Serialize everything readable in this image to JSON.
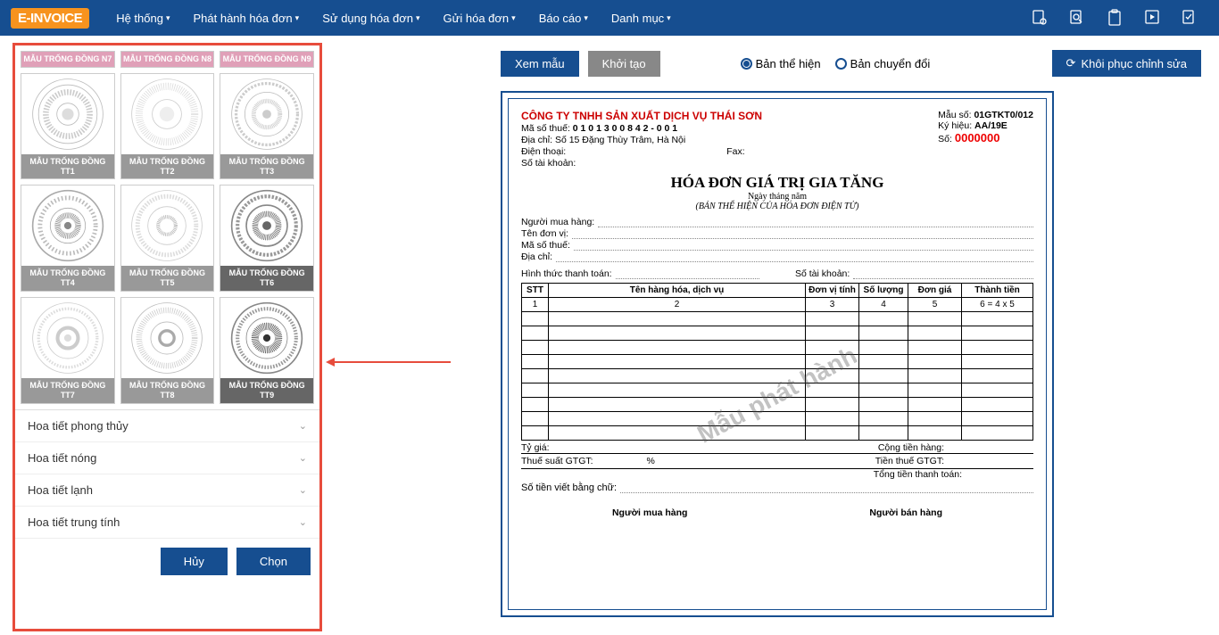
{
  "nav": {
    "logo_a": "E-",
    "logo_b": "INVOICE",
    "items": [
      "Hệ thống",
      "Phát hành hóa đơn",
      "Sử dụng hóa đơn",
      "Gửi hóa đơn",
      "Báo cáo",
      "Danh mục"
    ]
  },
  "templates": {
    "row0": [
      "MẪU TRỐNG ĐỒNG N7",
      "MẪU TRỐNG ĐỒNG N8",
      "MẪU TRỐNG ĐỒNG N9"
    ],
    "row1": [
      "MẪU TRỐNG ĐỒNG TT1",
      "MẪU TRỐNG ĐỒNG TT2",
      "MẪU TRỐNG ĐỒNG TT3"
    ],
    "row2": [
      "MẪU TRỐNG ĐỒNG TT4",
      "MẪU TRỐNG ĐỒNG TT5",
      "MẪU TRỐNG ĐỒNG TT6"
    ],
    "row3": [
      "MẪU TRỐNG ĐỒNG TT7",
      "MẪU TRỐNG ĐỒNG TT8",
      "MẪU TRỐNG ĐỒNG TT9"
    ]
  },
  "accordion": [
    "Hoa tiết phong thủy",
    "Hoa tiết nóng",
    "Hoa tiết lạnh",
    "Hoa tiết trung tính"
  ],
  "buttons": {
    "cancel": "Hủy",
    "select": "Chọn"
  },
  "toolbar": {
    "preview": "Xem mẫu",
    "init": "Khởi tạo",
    "radio1": "Bản thể hiện",
    "radio2": "Bản chuyển đổi",
    "restore": "Khôi phục chỉnh sửa"
  },
  "invoice": {
    "company": "CÔNG TY TNHH SẢN XUẤT DỊCH VỤ THÁI SƠN",
    "tax_lbl": "Mã số thuế:",
    "tax": "0 1 0 1 3 0 0 8 4 2 - 0 0 1",
    "addr_lbl": "Địa chỉ:",
    "addr": "Số 15 Đặng Thùy Trâm, Hà Nội",
    "phone_lbl": "Điện thoại:",
    "fax_lbl": "Fax:",
    "acct_lbl": "Số tài khoản:",
    "form_lbl": "Mẫu số:",
    "form": "01GTKT0/012",
    "serial_lbl": "Ký hiệu:",
    "serial": "AA/19E",
    "no_lbl": "Số:",
    "no": "0000000",
    "title": "HÓA ĐƠN GIÁ TRỊ GIA TĂNG",
    "date": "Ngày       tháng       năm",
    "sub2": "(BẢN THỂ HIỆN CỦA HÓA ĐƠN ĐIỆN TỬ)",
    "buyer": "Người mua hàng:",
    "unit": "Tên đơn vị:",
    "btax": "Mã số thuế:",
    "baddr": "Địa chỉ:",
    "paym": "Hình thức thanh toán:",
    "bacct": "Số tài khoản:",
    "th": [
      "STT",
      "Tên hàng hóa, dịch vụ",
      "Đơn vị tính",
      "Số lượng",
      "Đơn giá",
      "Thành tiền"
    ],
    "tn": [
      "1",
      "2",
      "3",
      "4",
      "5",
      "6 = 4 x 5"
    ],
    "rate": "Tỷ giá:",
    "subtotal": "Cộng tiền hàng:",
    "vatlbl": "Thuế suất GTGT:",
    "pct": "%",
    "vatamt": "Tiền thuế GTGT:",
    "grand": "Tổng tiền thanh toán:",
    "words": "Số tiền viết bằng chữ:",
    "sig1": "Người mua hàng",
    "sig2": "Người bán hàng",
    "watermark": "Mẫu phát hành"
  }
}
